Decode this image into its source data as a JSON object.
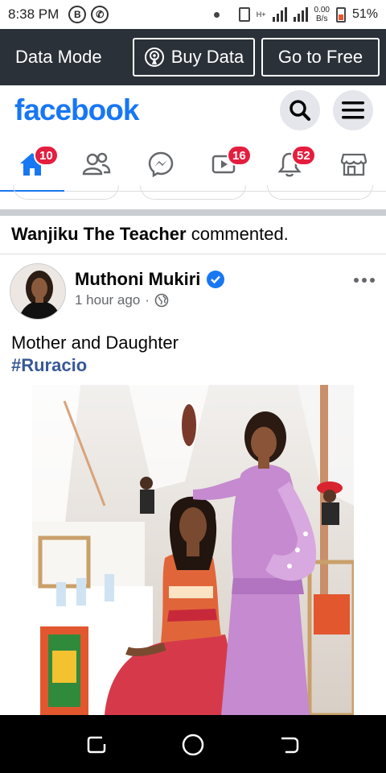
{
  "status_bar": {
    "time": "8:38 PM",
    "network_speed_value": "0.00",
    "network_speed_unit": "B/s",
    "network_type": "H+",
    "battery": "51%"
  },
  "data_bar": {
    "mode_label": "Data Mode",
    "buy_data_label": "Buy Data",
    "go_free_label": "Go to Free"
  },
  "header": {
    "logo": "facebook",
    "search_icon": "search-icon",
    "menu_icon": "hamburger-menu-icon"
  },
  "nav": {
    "items": [
      {
        "icon": "home-icon",
        "badge": "10",
        "active": true
      },
      {
        "icon": "friends-icon"
      },
      {
        "icon": "messenger-icon"
      },
      {
        "icon": "watch-icon",
        "badge": "16"
      },
      {
        "icon": "bell-icon",
        "badge": "52"
      },
      {
        "icon": "marketplace-icon"
      }
    ],
    "active_color": "#1877f2"
  },
  "feed": {
    "activity": {
      "actor": "Wanjiku The Teacher",
      "action": "commented."
    },
    "post": {
      "author": "Muthoni  Mukiri",
      "verified": true,
      "time": "1 hour ago",
      "separator": "·",
      "audience_icon": "globe-icon",
      "text": "Mother and Daughter",
      "hashtag": "#Ruracio"
    }
  },
  "colors": {
    "brand": "#1877f2",
    "badge": "#e41e3f",
    "data_bar_bg": "#2a3138"
  }
}
